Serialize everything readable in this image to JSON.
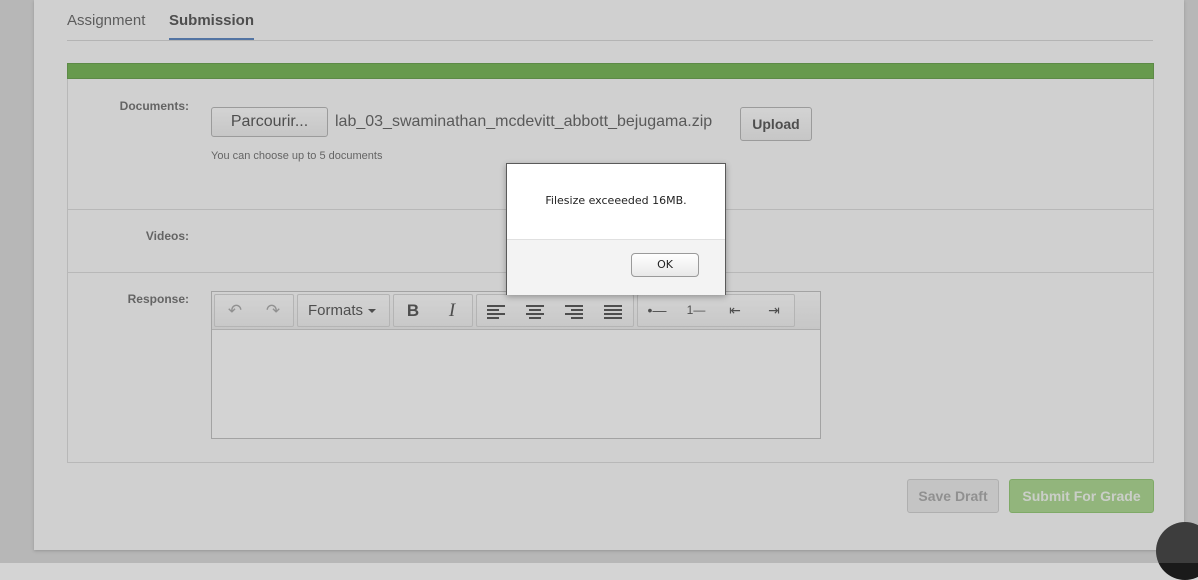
{
  "tabs": [
    {
      "label": "Assignment",
      "active": false
    },
    {
      "label": "Submission",
      "active": true
    }
  ],
  "documents": {
    "label": "Documents:",
    "browse_label": "Parcourir...",
    "filename": "lab_03_swaminathan_mcdevitt_abbott_bejugama.zip",
    "upload_label": "Upload",
    "hint": "You can choose up to 5 documents"
  },
  "videos": {
    "label": "Videos:"
  },
  "response": {
    "label": "Response:",
    "formats_label": "Formats"
  },
  "actions": {
    "save_draft": "Save Draft",
    "submit": "Submit For Grade"
  },
  "dialog": {
    "message": "Filesize exceeeded 16MB.",
    "ok_label": "OK"
  },
  "colors": {
    "progress_bar": "#5aa832",
    "active_tab_underline": "#3b6db5",
    "submit_button": "#9cd27a"
  }
}
